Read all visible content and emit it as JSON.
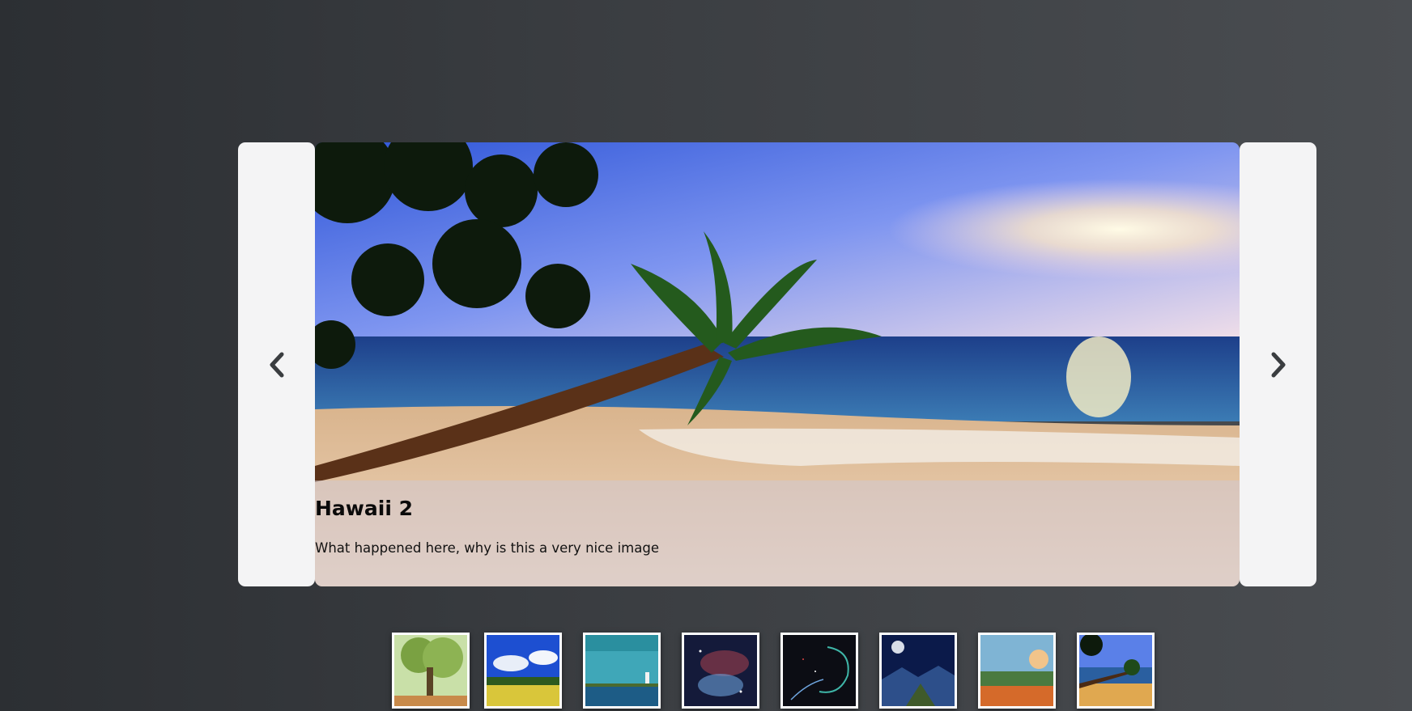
{
  "slider": {
    "prev_icon": "chevron-left-icon",
    "next_icon": "chevron-right-icon",
    "current_slide": {
      "title": "Hawaii 2",
      "description": "What happened here, why is this a very nice image"
    }
  },
  "thumbnails": [
    {
      "name": "tree"
    },
    {
      "name": "field-sky"
    },
    {
      "name": "lighthouse"
    },
    {
      "name": "nebula"
    },
    {
      "name": "space-head"
    },
    {
      "name": "planet-mountains"
    },
    {
      "name": "tropical-sunset"
    },
    {
      "name": "hawaii-beach"
    }
  ],
  "colors": {
    "background": "#3b3e42",
    "nav_bg": "#f4f4f5",
    "chevron": "#3a3d40"
  }
}
